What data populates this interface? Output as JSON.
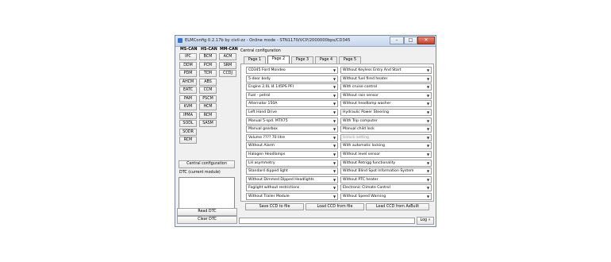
{
  "window": {
    "title": "ELMConfig 0.2.17b by civil-zz - Online mode - STN1170/VCP/2000000bps/CD345",
    "minimize": "–",
    "maximize": "□",
    "close": "✕"
  },
  "modules": {
    "ms_can_header": "MS-CAN",
    "hs_can_header": "HS-CAN",
    "mm_can_header": "MM-CAN",
    "ms_can": [
      "IPC",
      "DDM",
      "PDM",
      "AHCM",
      "EATC",
      "PAM",
      "KVM",
      "IPMA",
      "SODL",
      "SODR",
      "RCM"
    ],
    "hs_can": [
      "BCM",
      "PCM",
      "TCM",
      "ABS",
      "CCM",
      "PSCM",
      "HCM",
      "RCM",
      "SASM"
    ],
    "mm_can": [
      "ACM",
      "SRM",
      "CCDJ"
    ]
  },
  "left": {
    "central_configuration_button": "Central configuration",
    "dtc_label": "DTC (current module)",
    "read_dtc_button": "Read DTC",
    "clear_dtc_button": "Clear DTC"
  },
  "central": {
    "group_label": "Central configuration",
    "tabs": [
      "Page 1",
      "Page 2",
      "Page 3",
      "Page 4",
      "Page 5"
    ],
    "active_tab": "Page 2",
    "left_options": [
      "CD345 Ford Mondeo",
      "5-door body",
      "Engine 2.0L I4 145PS PFI",
      "Fuel - petrol",
      "Alternator 150A",
      "Left Hand Drive",
      "Manual 5-spd. MTX75",
      "Manual gearbox",
      "Volume ???? 70 litre",
      "Without Alarm",
      "Halogen Headlamps",
      "LH asymmetry",
      "Standard dipped light",
      "Without Dimmed Dipped Headlights",
      "Foglight without restrictions",
      "Without Trailer Module"
    ],
    "right_options": [
      "Without Keyless Entry And Start",
      "Without fuel fired heater",
      "With cruise control",
      "Without rain sensor",
      "Without headlamp washer",
      "Hydraulic Power Steering",
      "With Trip computer",
      "Manual child lock",
      "Unlock setting",
      "With automatic locking",
      "Without level sensor",
      "Without Retrigg functionality",
      "Without Blind Spot Information System",
      "Without PTC heater",
      "Electronic Climate Control",
      "Without Speed Warning"
    ],
    "disabled_right_index": 8,
    "save_button": "Save CCD to file",
    "load_button": "Load CCD from file",
    "load_asbuilt_button": "Load CCD from AsBuilt",
    "log_button": "Log »"
  }
}
